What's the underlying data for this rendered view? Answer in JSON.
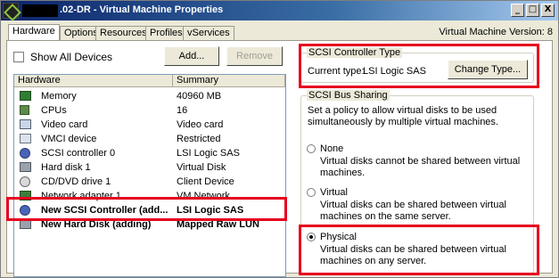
{
  "window": {
    "title": ".02-DR - Virtual Machine Properties",
    "version": "Virtual Machine Version: 8",
    "controls": [
      "_",
      "□",
      "X"
    ]
  },
  "tabs": [
    "Hardware",
    "Options",
    "Resources",
    "Profiles",
    "vServices"
  ],
  "left": {
    "show_all_label": "Show All Devices",
    "add_label": "Add...",
    "remove_label": "Remove",
    "columns": [
      "Hardware",
      "Summary"
    ],
    "rows": [
      {
        "name": "Memory",
        "summary": "40960 MB",
        "icon": "memory-icon"
      },
      {
        "name": "CPUs",
        "summary": "16",
        "icon": "cpu-icon"
      },
      {
        "name": "Video card",
        "summary": "Video card",
        "icon": "monitor-icon"
      },
      {
        "name": "VMCI device",
        "summary": "Restricted",
        "icon": "vmci-icon"
      },
      {
        "name": "SCSI controller 0",
        "summary": "LSI Logic SAS",
        "icon": "scsi-icon"
      },
      {
        "name": "Hard disk 1",
        "summary": "Virtual Disk",
        "icon": "harddisk-icon"
      },
      {
        "name": "CD/DVD drive 1",
        "summary": "Client Device",
        "icon": "cdrom-icon"
      },
      {
        "name": "Network adapter 1",
        "summary": "VM Network",
        "icon": "network-icon"
      },
      {
        "name": "New SCSI Controller (add...",
        "summary": "LSI Logic SAS",
        "icon": "scsi-icon"
      },
      {
        "name": "New Hard Disk (adding)",
        "summary": "Mapped Raw LUN",
        "icon": "harddisk-icon"
      }
    ]
  },
  "right": {
    "controller_type": {
      "legend": "SCSI Controller Type",
      "current_label": "Current type:",
      "current_value": "LSI Logic SAS",
      "change_label": "Change Type..."
    },
    "bus_sharing": {
      "legend": "SCSI Bus Sharing",
      "intro": "Set a policy to allow virtual disks to be used simultaneously by multiple virtual machines.",
      "options": [
        {
          "label": "None",
          "desc": "Virtual disks cannot be shared between virtual machines.",
          "selected": false
        },
        {
          "label": "Virtual",
          "desc": "Virtual disks can be shared between virtual machines on the same server.",
          "selected": false
        },
        {
          "label": "Physical",
          "desc": "Virtual disks can be shared between virtual machines on any server.",
          "selected": true
        }
      ]
    }
  },
  "colors": {
    "highlight": "#e6001e",
    "titlebar": "#0a246a",
    "panel": "#ece9d8"
  }
}
